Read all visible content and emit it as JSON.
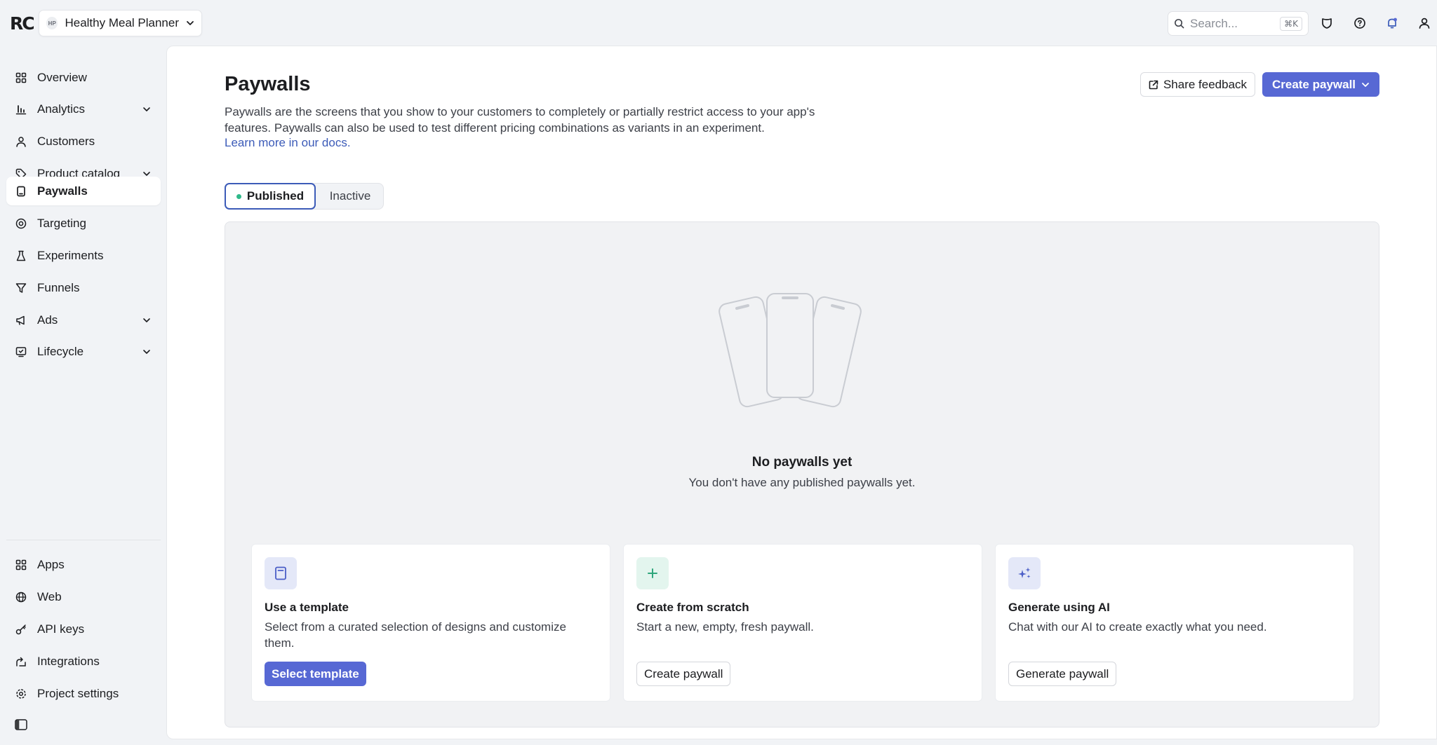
{
  "app": {
    "logo_text": "RC",
    "project": {
      "badge": "HP",
      "name": "Healthy Meal Planner"
    },
    "search": {
      "placeholder": "Search...",
      "shortcut": "⌘K"
    }
  },
  "sidebar": {
    "items": [
      {
        "label": "Overview",
        "icon": "grid-icon"
      },
      {
        "label": "Analytics",
        "icon": "bar-chart-icon",
        "expandable": true
      },
      {
        "label": "Customers",
        "icon": "user-icon"
      },
      {
        "label": "Product catalog",
        "icon": "tag-icon",
        "expandable": true
      },
      {
        "label": "Paywalls",
        "icon": "phone-icon",
        "active": true
      },
      {
        "label": "Targeting",
        "icon": "target-icon"
      },
      {
        "label": "Experiments",
        "icon": "flask-icon"
      },
      {
        "label": "Funnels",
        "icon": "funnel-icon"
      },
      {
        "label": "Ads",
        "icon": "megaphone-icon",
        "expandable": true
      },
      {
        "label": "Lifecycle",
        "icon": "lifecycle-icon",
        "expandable": true
      }
    ],
    "bottom_items": [
      {
        "label": "Apps",
        "icon": "apps-icon"
      },
      {
        "label": "Web",
        "icon": "globe-icon"
      },
      {
        "label": "API keys",
        "icon": "key-icon"
      },
      {
        "label": "Integrations",
        "icon": "integrations-icon"
      },
      {
        "label": "Project settings",
        "icon": "gear-icon"
      }
    ]
  },
  "page": {
    "title": "Paywalls",
    "description": "Paywalls are the screens that you show to your customers to completely or partially restrict access to your app's features. Paywalls can also be used to test different pricing combinations as variants in an experiment.",
    "docs_link": "Learn more in our docs.",
    "share_feedback": "Share feedback",
    "create_paywall": "Create paywall",
    "tabs": {
      "published": "Published",
      "inactive": "Inactive"
    },
    "empty_state": {
      "title": "No paywalls yet",
      "subtitle": "You don't have any published paywalls yet."
    },
    "cards": [
      {
        "title": "Use a template",
        "description": "Select from a curated selection of designs and customize them.",
        "button": "Select template"
      },
      {
        "title": "Create from scratch",
        "description": "Start a new, empty, fresh paywall.",
        "button": "Create paywall"
      },
      {
        "title": "Generate using AI",
        "description": "Chat with our AI to create exactly what you need.",
        "button": "Generate paywall"
      }
    ]
  },
  "colors": {
    "accent": "#5768d4",
    "link": "#3c5bb8",
    "published_dot": "#2fb98a",
    "background": "#f1f3f6"
  }
}
